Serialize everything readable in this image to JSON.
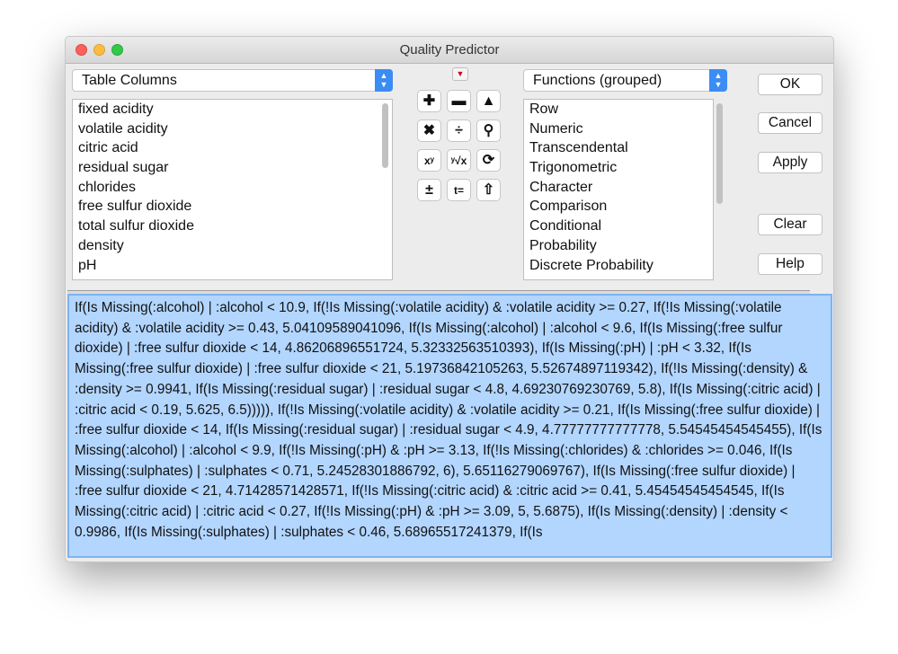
{
  "window": {
    "title": "Quality Predictor"
  },
  "left_select": {
    "value": "Table Columns"
  },
  "columns": [
    "fixed acidity",
    "volatile acidity",
    "citric acid",
    "residual sugar",
    "chlorides",
    "free sulfur dioxide",
    "total sulfur dioxide",
    "density",
    "pH"
  ],
  "right_select": {
    "value": "Functions (grouped)"
  },
  "functions": [
    "Row",
    "Numeric",
    "Transcendental",
    "Trigonometric",
    "Character",
    "Comparison",
    "Conditional",
    "Probability",
    "Discrete Probability"
  ],
  "keypad": [
    {
      "name": "plus-icon",
      "glyph": "✚"
    },
    {
      "name": "minus-icon",
      "glyph": "▬"
    },
    {
      "name": "caret-up-icon",
      "glyph": "▲"
    },
    {
      "name": "multiply-icon",
      "glyph": "✖"
    },
    {
      "name": "divide-icon",
      "glyph": "÷"
    },
    {
      "name": "lasso-icon",
      "glyph": "⚲"
    },
    {
      "name": "power-icon",
      "glyph": "xʸ"
    },
    {
      "name": "root-icon",
      "glyph": "ʸ√x"
    },
    {
      "name": "refresh-icon",
      "glyph": "⟳"
    },
    {
      "name": "plus-minus-icon",
      "glyph": "±"
    },
    {
      "name": "assign-icon",
      "glyph": "t="
    },
    {
      "name": "peel-icon",
      "glyph": "⇧"
    }
  ],
  "buttons": {
    "ok": "OK",
    "cancel": "Cancel",
    "apply": "Apply",
    "clear": "Clear",
    "help": "Help"
  },
  "formula": "If(Is Missing(:alcohol) | :alcohol < 10.9, If(!Is Missing(:volatile acidity) & :volatile acidity >= 0.27, If(!Is Missing(:volatile acidity) & :volatile acidity >= 0.43, 5.04109589041096, If(Is Missing(:alcohol) | :alcohol < 9.6, If(Is Missing(:free sulfur dioxide) | :free sulfur dioxide < 14, 4.86206896551724, 5.32332563510393), If(Is Missing(:pH) | :pH < 3.32, If(Is Missing(:free sulfur dioxide) | :free sulfur dioxide < 21, 5.19736842105263, 5.52674897119342), If(!Is Missing(:density) & :density >= 0.9941, If(Is Missing(:residual sugar) | :residual sugar < 4.8, 4.69230769230769, 5.8), If(Is Missing(:citric acid) | :citric acid < 0.19, 5.625, 6.5))))), If(!Is Missing(:volatile acidity) & :volatile acidity >= 0.21, If(Is Missing(:free sulfur dioxide) | :free sulfur dioxide < 14, If(Is Missing(:residual sugar) | :residual sugar < 4.9, 4.77777777777778, 5.54545454545455), If(Is Missing(:alcohol) | :alcohol < 9.9, If(!Is Missing(:pH) & :pH >= 3.13, If(!Is Missing(:chlorides) & :chlorides >= 0.046, If(Is Missing(:sulphates) | :sulphates < 0.71, 5.24528301886792, 6), 5.65116279069767), If(Is Missing(:free sulfur dioxide) | :free sulfur dioxide < 21, 4.71428571428571, If(!Is Missing(:citric acid) & :citric acid >= 0.41, 5.45454545454545, If(Is Missing(:citric acid) | :citric acid < 0.27, If(!Is Missing(:pH) & :pH >= 3.09, 5, 5.6875), If(Is Missing(:density) | :density < 0.9986, If(Is Missing(:sulphates) | :sulphates < 0.46, 5.68965517241379, If(Is"
}
